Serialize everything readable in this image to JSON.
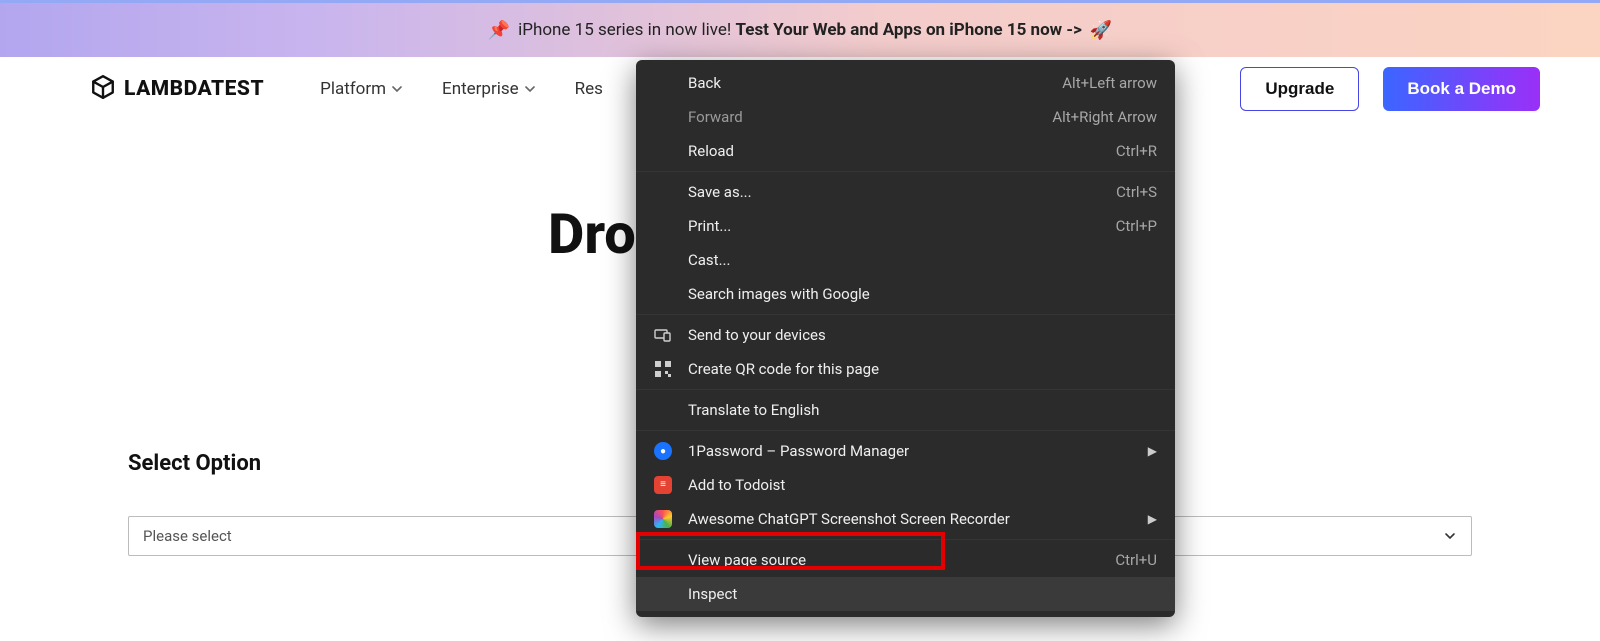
{
  "promo": {
    "pin": "📌",
    "normal": "iPhone 15 series in now live! ",
    "bold": "Test Your Web and Apps on iPhone 15 now ->",
    "rocket": "🚀"
  },
  "brand": "LAMBDATEST",
  "nav": {
    "platform": "Platform",
    "enterprise": "Enterprise",
    "resources": "Res"
  },
  "actions": {
    "upgrade": "Upgrade",
    "demo": "Book a Demo"
  },
  "heading": "Dro",
  "select": {
    "label": "Select Option",
    "placeholder": "Please select"
  },
  "context_menu": {
    "back": {
      "label": "Back",
      "shortcut": "Alt+Left arrow"
    },
    "forward": {
      "label": "Forward",
      "shortcut": "Alt+Right Arrow"
    },
    "reload": {
      "label": "Reload",
      "shortcut": "Ctrl+R"
    },
    "save_as": {
      "label": "Save as...",
      "shortcut": "Ctrl+S"
    },
    "print": {
      "label": "Print...",
      "shortcut": "Ctrl+P"
    },
    "cast": {
      "label": "Cast..."
    },
    "search_images": {
      "label": "Search images with Google"
    },
    "send_devices": {
      "label": "Send to your devices"
    },
    "qr_code": {
      "label": "Create QR code for this page"
    },
    "translate": {
      "label": "Translate to English"
    },
    "onepassword": {
      "label": "1Password – Password Manager"
    },
    "todoist": {
      "label": "Add to Todoist"
    },
    "awesome": {
      "label": "Awesome ChatGPT Screenshot  Screen Recorder"
    },
    "view_source": {
      "label": "View page source",
      "shortcut": "Ctrl+U"
    },
    "inspect": {
      "label": "Inspect"
    }
  }
}
